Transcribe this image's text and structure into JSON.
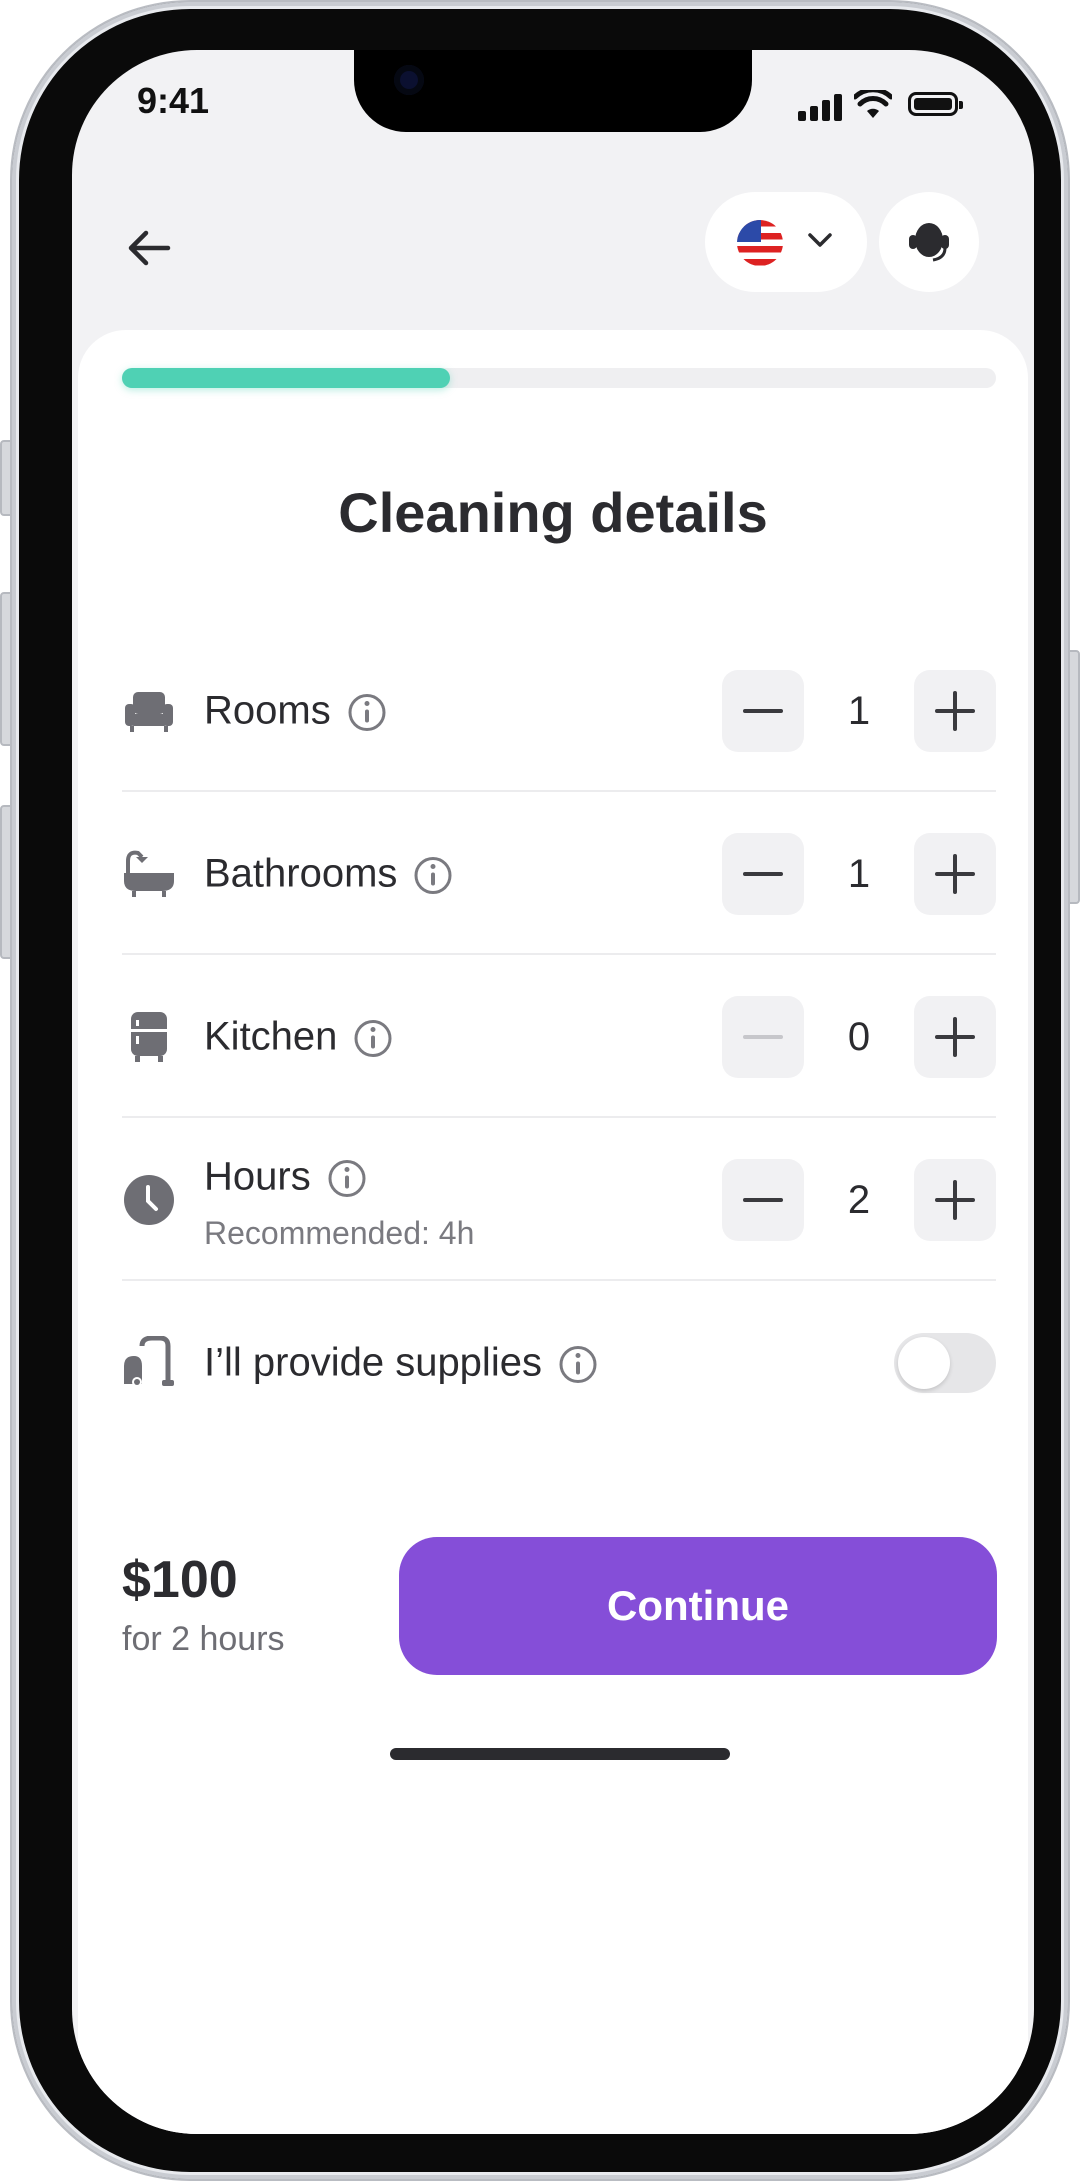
{
  "status": {
    "time": "9:41"
  },
  "header": {
    "language_icon": "us-flag-icon",
    "support_icon": "headset-icon"
  },
  "progress": {
    "fraction": 0.375,
    "color": "#4fd1b4"
  },
  "page": {
    "title": "Cleaning details"
  },
  "items": [
    {
      "label": "Rooms",
      "value": "1",
      "icon": "armchair-icon"
    },
    {
      "label": "Bathrooms",
      "value": "1",
      "icon": "bathtub-icon"
    },
    {
      "label": "Kitchen",
      "value": "0",
      "icon": "fridge-icon"
    },
    {
      "label": "Hours",
      "value": "2",
      "sublabel": "Recommended: 4h",
      "icon": "clock-icon"
    }
  ],
  "supplies": {
    "label": "I’ll provide supplies",
    "enabled": false,
    "icon": "vacuum-icon"
  },
  "footer": {
    "price": "$100",
    "price_note": "for 2 hours",
    "continue_label": "Continue",
    "accent": "#854ed8"
  }
}
